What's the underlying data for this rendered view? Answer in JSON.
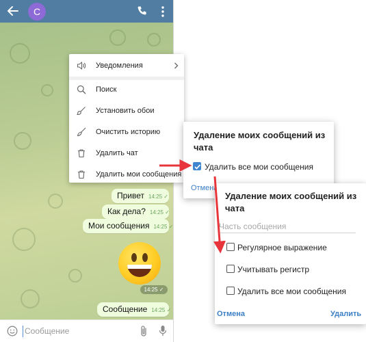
{
  "header": {
    "avatar_letter": "С"
  },
  "chat": {
    "messages": [
      {
        "text": "Привет",
        "time": "14:25"
      },
      {
        "text": "Как дела?",
        "time": "14:25"
      },
      {
        "text": "Мои сообщения",
        "time": "14:25"
      },
      {
        "text": "Сообщение",
        "time": "14:25"
      }
    ],
    "emoji_time": "14:25"
  },
  "composer": {
    "placeholder": "Сообщение"
  },
  "menu": {
    "items": [
      {
        "label": "Уведомления",
        "icon": "speaker-icon"
      },
      {
        "label": "Поиск",
        "icon": "search-icon"
      },
      {
        "label": "Установить обои",
        "icon": "paint-brush-icon"
      },
      {
        "label": "Очистить историю",
        "icon": "broom-icon"
      },
      {
        "label": "Удалить чат",
        "icon": "trash-icon"
      },
      {
        "label": "Удалить мои сообщения",
        "icon": "trash-icon"
      }
    ]
  },
  "dialog1": {
    "title": "Удаление моих сообщений из чата",
    "checkbox_label": "Удалить все мои сообщения",
    "checkbox_checked": true,
    "cancel_label": "Отмена"
  },
  "dialog2": {
    "title": "Удаление моих сообщений из чата",
    "input_placeholder": "Часть сообщения",
    "options": [
      {
        "label": "Регулярное выражение",
        "checked": false
      },
      {
        "label": "Учитывать регистр",
        "checked": false
      },
      {
        "label": "Удалить все мои сообщения",
        "checked": false
      }
    ],
    "cancel_label": "Отмена",
    "delete_label": "Удалить"
  },
  "colors": {
    "header": "#517da2",
    "accent": "#3a7fc6",
    "arrow": "#e8353b",
    "bubble": "#effdde"
  }
}
